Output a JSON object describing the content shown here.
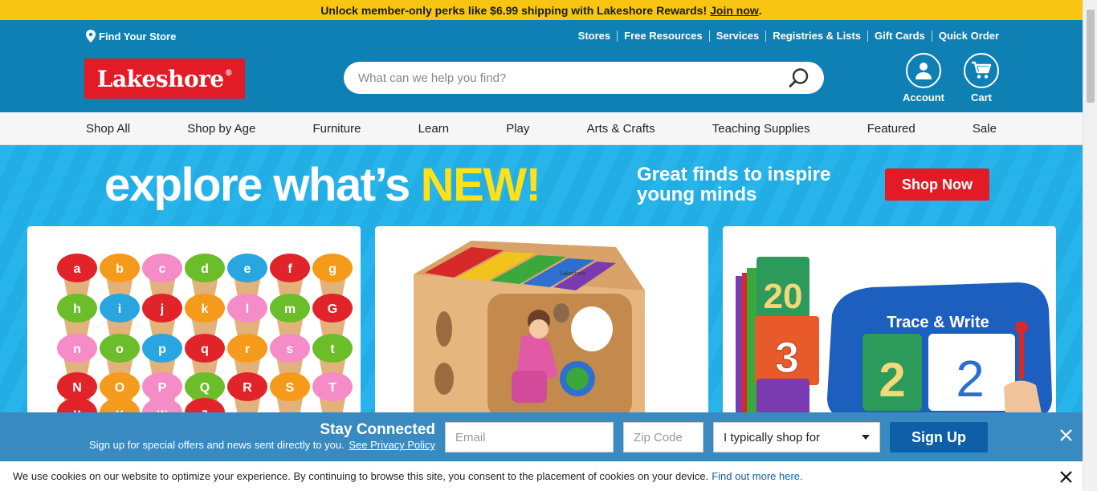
{
  "promo": {
    "text": "Unlock member-only perks like $6.99 shipping with Lakeshore Rewards!",
    "link": "Join now",
    "period": "."
  },
  "header": {
    "find_store": "Find Your Store",
    "utility_links": [
      "Stores",
      "Free Resources",
      "Services",
      "Registries & Lists",
      "Gift Cards",
      "Quick Order"
    ],
    "logo": "Lakeshore",
    "logo_mark": "®",
    "search_placeholder": "What can we help you find?",
    "account_label": "Account",
    "cart_label": "Cart"
  },
  "nav": {
    "items": [
      "Shop All",
      "Shop by Age",
      "Furniture",
      "Learn",
      "Play",
      "Arts & Crafts",
      "Teaching Supplies",
      "Featured",
      "Sale"
    ]
  },
  "hero": {
    "headline": "explore what’s",
    "headline_new": "NEW!",
    "subheadline": "Great finds to inspire young minds",
    "cta": "Shop Now",
    "cards": [
      {
        "scoops": [
          "a",
          "b",
          "c",
          "d",
          "e",
          "f",
          "g",
          "h",
          "i",
          "j",
          "k",
          "l",
          "m",
          "G",
          "n",
          "o",
          "p",
          "q",
          "r",
          "s",
          "t",
          "N",
          "O",
          "P",
          "Q",
          "R",
          "S",
          "T",
          "u",
          "v",
          "w",
          "z"
        ]
      },
      {
        "brand": "Lakeshore"
      },
      {
        "title": "Trace & Write",
        "numbers": [
          "20",
          "3",
          "2",
          "2"
        ]
      }
    ]
  },
  "signup": {
    "title": "Stay Connected",
    "subtitle": "Sign up for special offers and news sent directly to you.",
    "privacy_link": "See Privacy Policy",
    "email_placeholder": "Email",
    "zip_placeholder": "Zip Code",
    "shop_for": "I typically shop for",
    "button": "Sign Up"
  },
  "cookie": {
    "text": "We use cookies on our website to optimize your experience. By continuing to browse this site, you consent to the placement of cookies on your device.",
    "link": "Find out more here."
  },
  "colors": {
    "promo": "#f8c612",
    "header": "#0e80b3",
    "logo": "#e21b26",
    "hero": "#27b4ea",
    "new": "#ffe11a",
    "signup": "#3a8ac2",
    "button": "#0d5fa8"
  }
}
